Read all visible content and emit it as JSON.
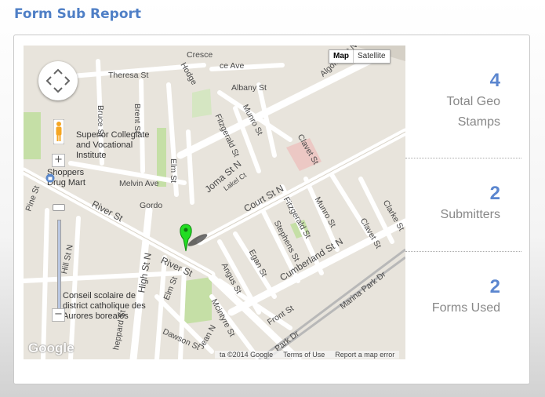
{
  "page": {
    "title": "Form Sub Report"
  },
  "map": {
    "type_controls": {
      "map_label": "Map",
      "satellite_label": "Satellite",
      "selected": "Map"
    },
    "zoom": {
      "in_label": "+",
      "out_label": "−"
    },
    "street_labels": [
      "Cresce",
      "ce Ave",
      "Hodge",
      "Theresa St",
      "Albany St",
      "Algoma St N",
      "Bruce St",
      "Brent St",
      "Munro St",
      "Fitzgerald St",
      "Clavet St",
      "Elm St",
      "Joma St N",
      "Lakel Ct",
      "Court St N",
      "Melvin Ave",
      "Gordo",
      "River St",
      "Fitzgerald St",
      "Munro St",
      "Clarke St",
      "Stephens St",
      "Clavet St",
      "Cumberland St N",
      "Pine St",
      "Hill St N",
      "High St N",
      "River St",
      "Egan St",
      "Angus St",
      "Marina Park Dr",
      "Mcintyre St",
      "Elm St",
      "Front St",
      "Dawson St",
      "Jean N",
      "heppard St",
      "Park Dr",
      "Hill St N",
      "Pine St",
      "Elm St"
    ],
    "poi": [
      {
        "name": "Superior Collegiate and Vocational Institute"
      },
      {
        "name": "Shoppers Drug Mart"
      },
      {
        "name": "Conseil scolaire de district catholique des Aurores boreales"
      }
    ],
    "google_logo": "Google",
    "attribution": {
      "data": "ta ©2014 Google",
      "terms": "Terms of Use",
      "report": "Report a map error"
    },
    "marker_color": "#22dd22"
  },
  "stats": [
    {
      "value": "4",
      "label_line1": "Total Geo",
      "label_line2": "Stamps"
    },
    {
      "value": "2",
      "label_line1": "Submitters",
      "label_line2": ""
    },
    {
      "value": "2",
      "label_line1": "Forms Used",
      "label_line2": ""
    }
  ],
  "colors": {
    "accent": "#4f7fc6",
    "stat_number": "#5b86cf",
    "stat_label": "#888888"
  }
}
